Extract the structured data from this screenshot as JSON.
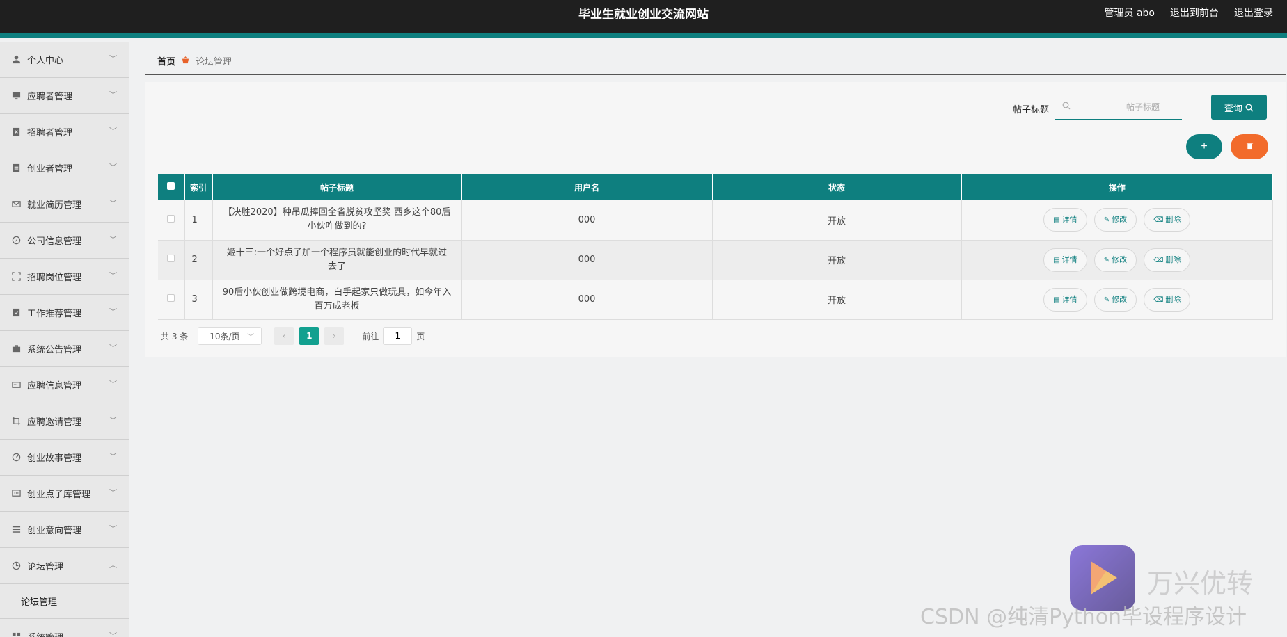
{
  "header": {
    "title": "毕业生就业创业交流网站",
    "user": "管理员 abo",
    "to_front": "退出到前台",
    "logout": "退出登录"
  },
  "sidebar": {
    "items": [
      {
        "label": "个人中心",
        "icon": "person-icon"
      },
      {
        "label": "应聘者管理",
        "icon": "monitor-icon"
      },
      {
        "label": "招聘者管理",
        "icon": "clipboard-x-icon"
      },
      {
        "label": "创业者管理",
        "icon": "clipboard-icon"
      },
      {
        "label": "就业简历管理",
        "icon": "mail-icon"
      },
      {
        "label": "公司信息管理",
        "icon": "compass-icon"
      },
      {
        "label": "招聘岗位管理",
        "icon": "frame-icon"
      },
      {
        "label": "工作推荐管理",
        "icon": "clipboard-check-icon"
      },
      {
        "label": "系统公告管理",
        "icon": "briefcase-icon"
      },
      {
        "label": "应聘信息管理",
        "icon": "card-icon"
      },
      {
        "label": "应聘邀请管理",
        "icon": "crop-icon"
      },
      {
        "label": "创业故事管理",
        "icon": "gauge-icon"
      },
      {
        "label": "创业点子库管理",
        "icon": "chat-icon"
      },
      {
        "label": "创业意向管理",
        "icon": "list-icon"
      },
      {
        "label": "论坛管理",
        "icon": "clock-icon"
      }
    ],
    "open_sub": "论坛管理",
    "last": {
      "label": "系统管理",
      "icon": "grid-icon"
    }
  },
  "breadcrumb": {
    "home": "首页",
    "current": "论坛管理"
  },
  "search": {
    "label": "帖子标题",
    "placeholder": "帖子标题",
    "value": "",
    "button": "查询"
  },
  "actions": {
    "add": "+",
    "delete": "🗑"
  },
  "table": {
    "columns": [
      "索引",
      "帖子标题",
      "用户名",
      "状态",
      "操作"
    ],
    "rows": [
      {
        "index": "1",
        "title": "【决胜2020】种吊瓜捧回全省脱贫攻坚奖 西乡这个80后小伙咋做到的?",
        "user": "000",
        "status": "开放"
      },
      {
        "index": "2",
        "title": "姬十三:一个好点子加一个程序员就能创业的时代早就过去了",
        "user": "000",
        "status": "开放"
      },
      {
        "index": "3",
        "title": "90后小伙创业做跨境电商，白手起家只做玩具，如今年入百万成老板",
        "user": "000",
        "status": "开放"
      }
    ],
    "row_actions": {
      "detail": "详情",
      "edit": "修改",
      "delete": "删除"
    }
  },
  "pagination": {
    "total": "共 3 条",
    "page_size": "10条/页",
    "current_page": "1",
    "goto_prefix": "前往",
    "goto_value": "1",
    "goto_suffix": "页"
  },
  "watermark": {
    "brand": "万兴优转",
    "credit": "CSDN @纯清Python毕设程序设计"
  },
  "colors": {
    "primary": "#0e7f7f",
    "danger": "#f26b2b",
    "active_page": "#12a08f",
    "topbar": "#1f1f1f"
  }
}
